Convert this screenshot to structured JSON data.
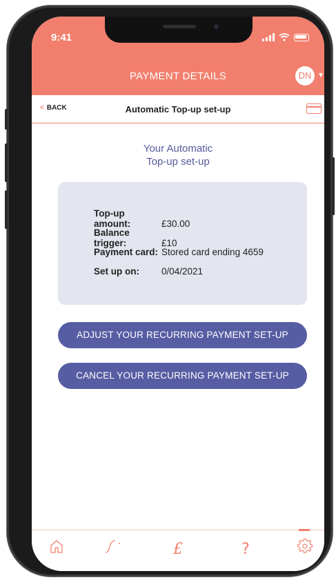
{
  "status_bar": {
    "time": "9:41"
  },
  "header": {
    "title": "PAYMENT DETAILS",
    "avatar_initials": "DN"
  },
  "subheader": {
    "back_label": "BACK",
    "title": "Automatic Top-up set-up"
  },
  "heading": {
    "line1": "Your Automatic",
    "line2": "Top-up set-up"
  },
  "details": [
    {
      "label": "Top-up amount:",
      "value": "£30.00"
    },
    {
      "label": "Balance trigger:",
      "value": "£10"
    },
    {
      "label": "Payment card:",
      "value": "Stored card ending 4659"
    },
    {
      "label": "Set up on:",
      "value": "0/04/2021"
    }
  ],
  "buttons": {
    "adjust": "ADJUST YOUR RECURRING PAYMENT SET-UP",
    "cancel": "CANCEL YOUR RECURRING PAYMENT SET-UP"
  },
  "tabbar": {
    "items": [
      {
        "icon": "home-icon"
      },
      {
        "icon": "graph-icon"
      },
      {
        "icon": "pound-icon",
        "glyph": "£"
      },
      {
        "icon": "help-icon",
        "glyph": "?"
      },
      {
        "icon": "settings-icon",
        "active": true
      }
    ]
  },
  "colors": {
    "accent": "#f27f6d",
    "primary": "#575da3",
    "panel": "#e3e6ef",
    "heading": "#565b9c"
  }
}
